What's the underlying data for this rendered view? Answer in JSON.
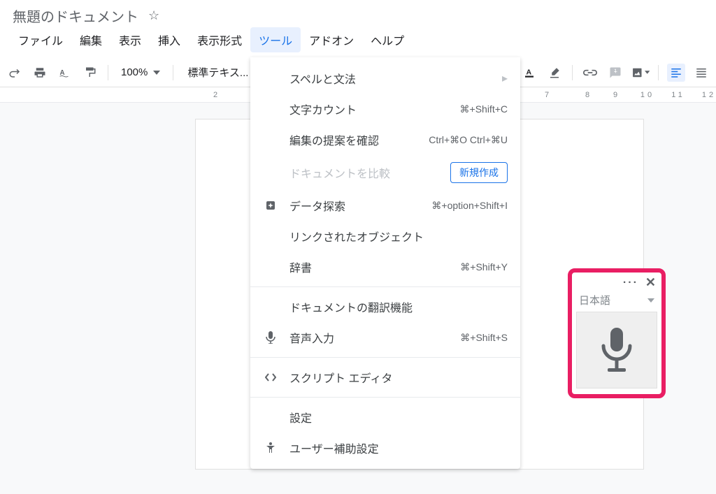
{
  "doc_title": "無題のドキュメント",
  "menus": {
    "file": "ファイル",
    "edit": "編集",
    "view": "表示",
    "insert": "挿入",
    "format": "表示形式",
    "tools": "ツール",
    "addons": "アドオン",
    "help": "ヘルプ"
  },
  "toolbar": {
    "zoom": "100%",
    "style": "標準テキス..."
  },
  "ruler": [
    "2",
    "",
    "",
    "",
    "",
    "",
    "",
    "7",
    "8",
    "9",
    "10",
    "11",
    "12"
  ],
  "dropdown": {
    "spell": "スペルと文法",
    "word_count": {
      "label": "文字カウント",
      "sc": "⌘+Shift+C"
    },
    "review": {
      "label": "編集の提案を確認",
      "sc": "Ctrl+⌘O Ctrl+⌘U"
    },
    "compare": {
      "label": "ドキュメントを比較",
      "chip": "新規作成"
    },
    "explore": {
      "label": "データ探索",
      "sc": "⌘+option+Shift+I"
    },
    "linked": "リンクされたオブジェクト",
    "dict": {
      "label": "辞書",
      "sc": "⌘+Shift+Y"
    },
    "translate": "ドキュメントの翻訳機能",
    "voice": {
      "label": "音声入力",
      "sc": "⌘+Shift+S"
    },
    "script": "スクリプト エディタ",
    "settings": "設定",
    "a11y": "ユーザー補助設定"
  },
  "voice_panel": {
    "lang": "日本語"
  }
}
